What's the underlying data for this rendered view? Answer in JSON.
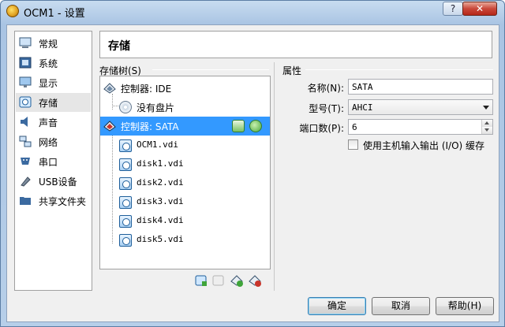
{
  "window": {
    "title": "OCM1 - 设置",
    "help_label": "?",
    "close_label": "✕"
  },
  "sidebar": {
    "items": [
      {
        "label": "常规",
        "icon": "general-icon"
      },
      {
        "label": "系统",
        "icon": "system-icon"
      },
      {
        "label": "显示",
        "icon": "display-icon"
      },
      {
        "label": "存储",
        "icon": "storage-icon",
        "active": true
      },
      {
        "label": "声音",
        "icon": "audio-icon"
      },
      {
        "label": "网络",
        "icon": "network-icon"
      },
      {
        "label": "串口",
        "icon": "serial-icon"
      },
      {
        "label": "USB设备",
        "icon": "usb-icon"
      },
      {
        "label": "共享文件夹",
        "icon": "shared-folder-icon"
      }
    ]
  },
  "header": {
    "title": "存储"
  },
  "storage_tree": {
    "label": "存储树(S)",
    "nodes": [
      {
        "label": "控制器: IDE",
        "type": "controller"
      },
      {
        "label": "没有盘片",
        "type": "optical"
      },
      {
        "label": "控制器: SATA",
        "type": "controller",
        "selected": true
      },
      {
        "label": "OCM1.vdi",
        "type": "disk"
      },
      {
        "label": "disk1.vdi",
        "type": "disk"
      },
      {
        "label": "disk2.vdi",
        "type": "disk"
      },
      {
        "label": "disk3.vdi",
        "type": "disk"
      },
      {
        "label": "disk4.vdi",
        "type": "disk"
      },
      {
        "label": "disk5.vdi",
        "type": "disk"
      }
    ]
  },
  "properties": {
    "section_label": "属性",
    "name_label": "名称(N):",
    "name_value": "SATA",
    "type_label": "型号(T):",
    "type_value": "AHCI",
    "ports_label": "端口数(P):",
    "ports_value": "6",
    "cache_label": "使用主机输入输出 (I/O) 缓存",
    "cache_checked": false
  },
  "buttons": {
    "ok": "确定",
    "cancel": "取消",
    "help": "帮助(H)"
  },
  "colors": {
    "selection": "#3399ff",
    "title_bar": "#b7cfe9"
  }
}
